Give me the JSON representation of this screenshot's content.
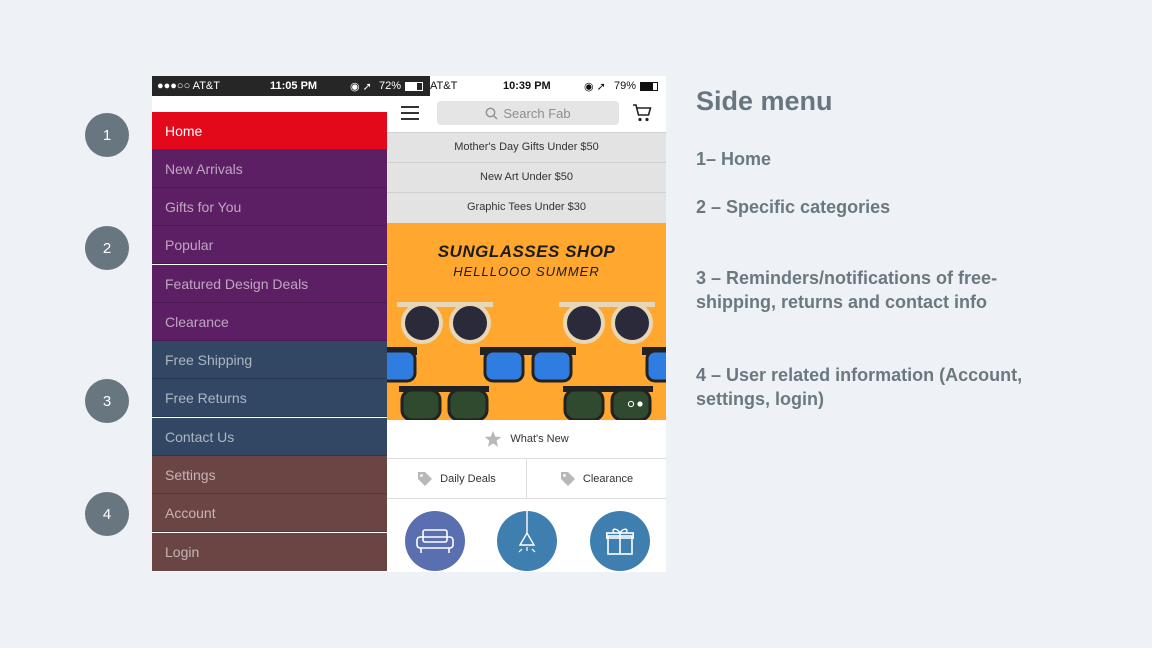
{
  "badges": [
    "1",
    "2",
    "3",
    "4"
  ],
  "phone_left": {
    "status_bar": {
      "carrier": "●●●○○ AT&T",
      "time": "11:05 PM",
      "battery": "72%"
    },
    "menu_items": [
      {
        "label": "Home",
        "group": "home"
      },
      {
        "label": "New Arrivals",
        "group": "categories"
      },
      {
        "label": "Gifts for You",
        "group": "categories"
      },
      {
        "label": "Popular",
        "group": "categories"
      },
      {
        "label": "Featured Design Deals",
        "group": "categories"
      },
      {
        "label": "Clearance",
        "group": "categories"
      },
      {
        "label": "Free Shipping",
        "group": "reminders"
      },
      {
        "label": "Free Returns",
        "group": "reminders"
      },
      {
        "label": "Contact Us",
        "group": "reminders"
      },
      {
        "label": "Settings",
        "group": "user"
      },
      {
        "label": "Account",
        "group": "user"
      },
      {
        "label": "Login",
        "group": "user"
      }
    ]
  },
  "phone_right": {
    "status_bar": {
      "carrier": "AT&T",
      "time": "10:39 PM",
      "battery": "79%"
    },
    "search_placeholder": "Search Fab",
    "promos": [
      "Mother's Day Gifts Under $50",
      "New Art Under $50",
      "Graphic Tees Under $30"
    ],
    "banner": {
      "title": "SUNGLASSES SHOP",
      "subtitle": "HELLLOOO SUMMER"
    },
    "whats_new": "What's New",
    "tabs": [
      "Daily Deals",
      "Clearance"
    ],
    "category_icons": [
      "sofa-icon",
      "lamp-icon",
      "gift-icon"
    ]
  },
  "annotations": {
    "heading": "Side menu",
    "items": [
      "1– Home",
      "2 – Specific categories",
      "3 – Reminders/notifications of free-shipping, returns and contact info",
      "4 – User related information (Account, settings, login)"
    ]
  },
  "colors": {
    "home": "#e3081a",
    "categories": "#5c1f63",
    "reminders": "#314764",
    "user": "#6b4444",
    "banner": "#ffa72f",
    "category_circle": "#3f7fb0"
  }
}
